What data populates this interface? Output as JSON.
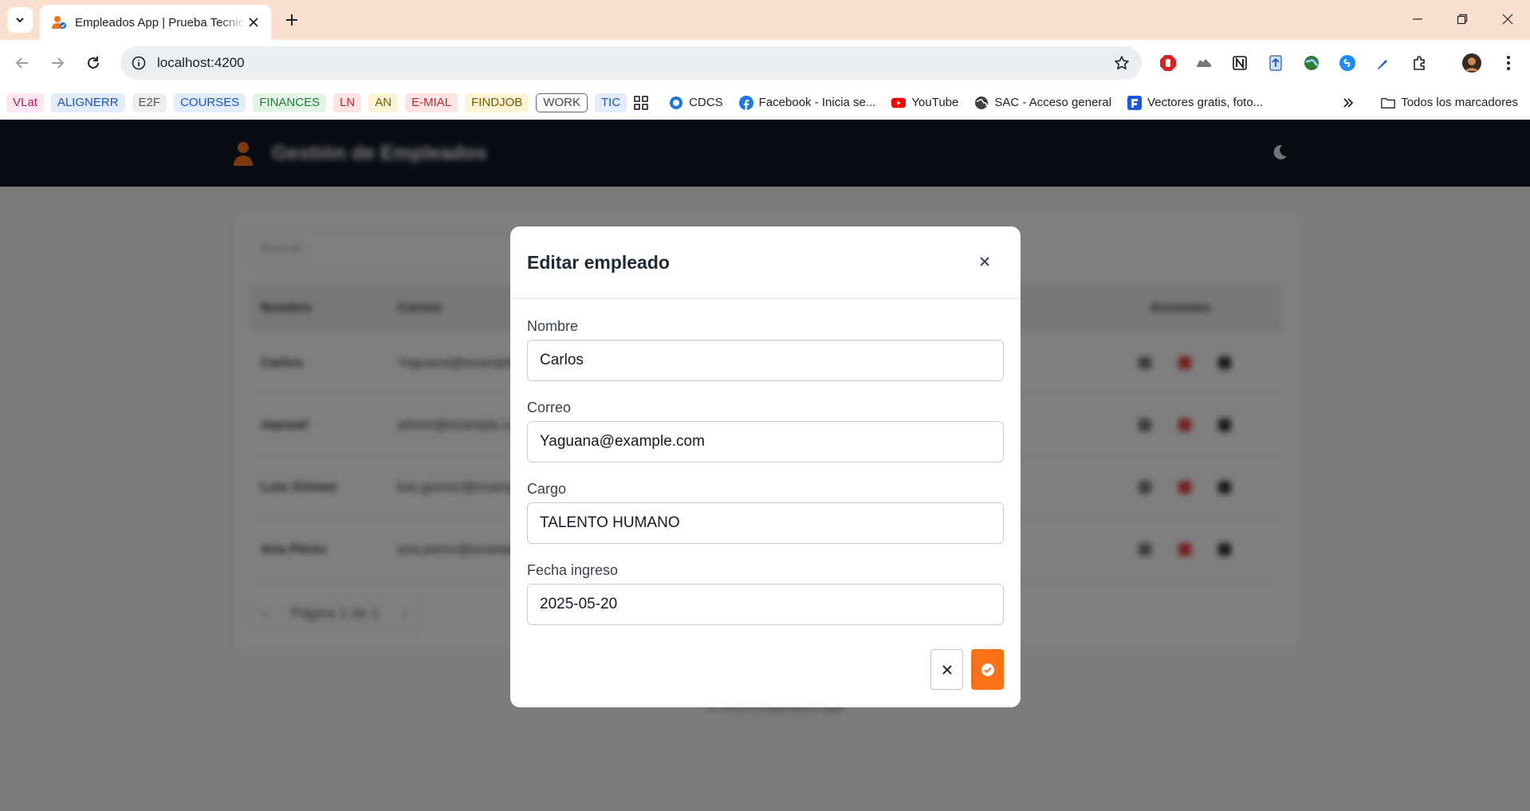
{
  "browser": {
    "tab_title": "Empleados App | Prueba Tecnica",
    "url": "localhost:4200"
  },
  "bookmarks": {
    "chips": [
      {
        "label": "VLat",
        "bg": "#fde7f3",
        "fg": "#c2185b"
      },
      {
        "label": "ALIGNERR",
        "bg": "#e3ecfb",
        "fg": "#1a56c4"
      },
      {
        "label": "E2F",
        "bg": "#eeeeee",
        "fg": "#555555"
      },
      {
        "label": "COURSES",
        "bg": "#e3ecfb",
        "fg": "#1a56c4"
      },
      {
        "label": "FINANCES",
        "bg": "#e3f4e7",
        "fg": "#1e7e34"
      },
      {
        "label": "LN",
        "bg": "#fde4e4",
        "fg": "#c62828"
      },
      {
        "label": "AN",
        "bg": "#fff3d6",
        "fg": "#7a5a00"
      },
      {
        "label": "E-MIAL",
        "bg": "#fde4e4",
        "fg": "#c62828"
      },
      {
        "label": "FINDJOB",
        "bg": "#fff3d6",
        "fg": "#7a5a00"
      },
      {
        "label": "WORK",
        "bg": "#ffffff",
        "fg": "#444444"
      },
      {
        "label": "TIC",
        "bg": "#e3ecfb",
        "fg": "#1a56c4"
      }
    ],
    "links": [
      "CDCS",
      "Facebook - Inicia se...",
      "YouTube",
      "SAC - Acceso general",
      "Vectores gratis, foto..."
    ],
    "all_bookmarks": "Todos los marcadores"
  },
  "app": {
    "title": "Gestión de Empleados",
    "search_placeholder": "Buscar...",
    "columns": [
      "Nombre",
      "Correo",
      "Acciones"
    ],
    "rows": [
      {
        "name": "Carlos",
        "email": "Yaguana@example.com"
      },
      {
        "name": "manuel",
        "email": "admin@example.com"
      },
      {
        "name": "Luis Gómez",
        "email": "luis.gomez@example.com"
      },
      {
        "name": "Ana Pérez",
        "email": "ana.perez@example.com"
      }
    ],
    "pagination": "Página 1 de 1",
    "footer": "© 2025 Empleados App"
  },
  "modal": {
    "title": "Editar empleado",
    "fields": {
      "nombre": {
        "label": "Nombre",
        "value": "Carlos"
      },
      "correo": {
        "label": "Correo",
        "value": "Yaguana@example.com"
      },
      "cargo": {
        "label": "Cargo",
        "value": "TALENTO HUMANO"
      },
      "fecha": {
        "label": "Fecha ingreso",
        "value": "2025-05-20"
      }
    }
  },
  "colors": {
    "accent": "#f97316",
    "header_bg": "#111827",
    "tab_strip": "#fbe0d0"
  },
  "icons": [
    "chevron-down-icon",
    "close-icon",
    "plus-icon",
    "minimize-icon",
    "restore-icon",
    "back-arrow-icon",
    "forward-arrow-icon",
    "reload-icon",
    "site-info-icon",
    "star-icon",
    "extensions-icon",
    "kebab-menu-icon",
    "apps-grid-icon",
    "folder-icon",
    "check-circle-icon",
    "moon-icon"
  ]
}
